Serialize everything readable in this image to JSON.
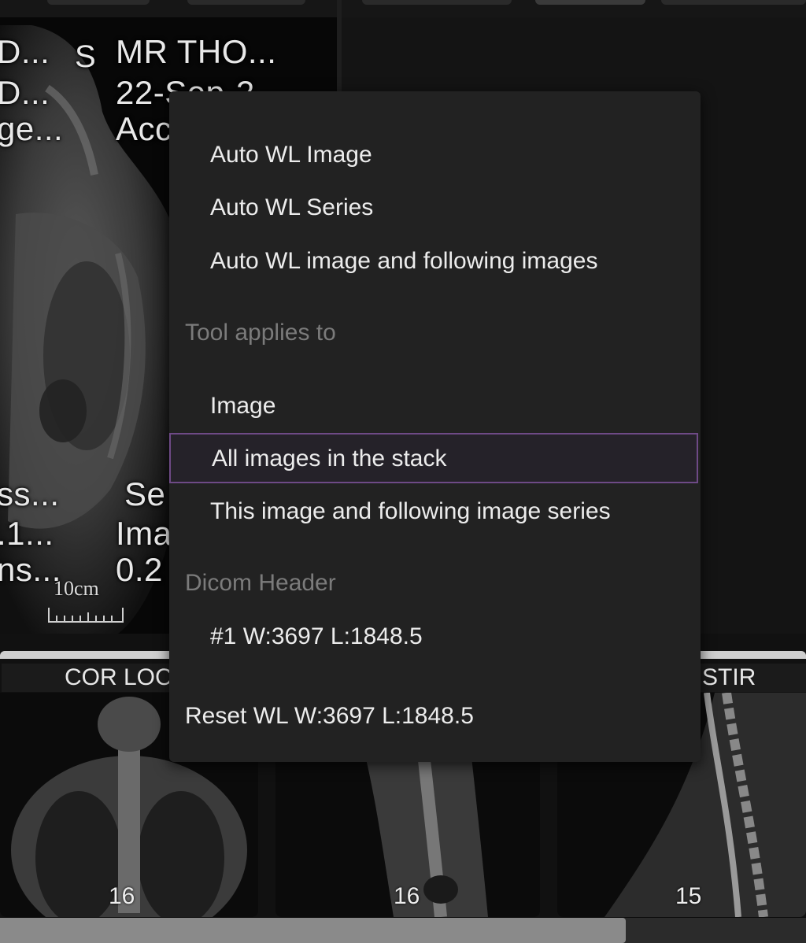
{
  "viewport": {
    "overlay_left": [
      "D...",
      "D...",
      "ge...",
      "ss...",
      ".1...",
      "ns..."
    ],
    "orientation_marker": "S",
    "overlay_right": [
      "MR THO...",
      "22-Sep-2",
      "Acc",
      "Se",
      "Ima",
      "0.2"
    ],
    "scale_label": "10cm"
  },
  "context_menu": {
    "items_top": [
      "Auto WL Image",
      "Auto WL Series",
      "Auto WL image and following images"
    ],
    "header_tool": "Tool applies to",
    "items_scope": [
      "Image",
      "All images in the stack",
      "This image and following image series"
    ],
    "selected_item": "All images in the stack",
    "header_dicom": "Dicom Header",
    "dicom_preset": "#1 W:3697 L:1848.5",
    "reset": "Reset WL W:3697 L:1848.5"
  },
  "thumbnails": [
    {
      "label": "COR LOC",
      "number": "16"
    },
    {
      "label": "",
      "number": "16"
    },
    {
      "label": "STIR",
      "number": "15"
    }
  ],
  "colors": {
    "menu_bg": "#222222",
    "selection_border": "#6e4a86",
    "header_text": "#7b7b7b"
  }
}
